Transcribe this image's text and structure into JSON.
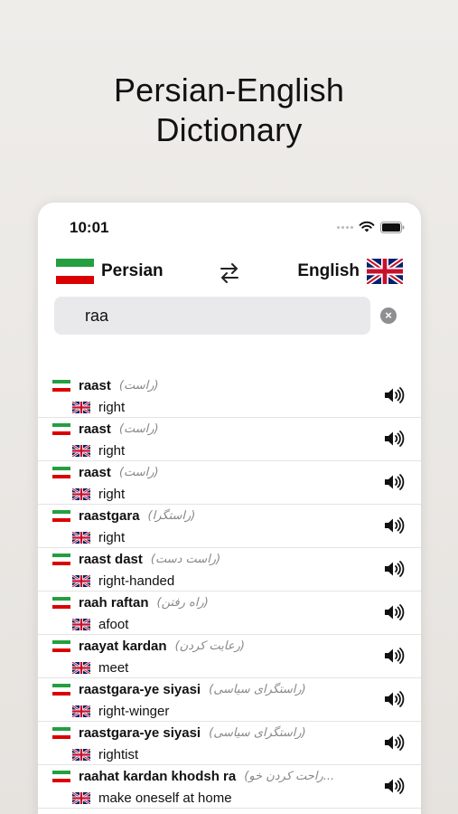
{
  "headline": {
    "line1": "Persian-English",
    "line2": "Dictionary"
  },
  "status": {
    "time": "10:01"
  },
  "languages": {
    "source": "Persian",
    "target": "English"
  },
  "search": {
    "value": "raa"
  },
  "results": [
    {
      "translit": "raast",
      "persian": "(راست)",
      "english": "right"
    },
    {
      "translit": "raast",
      "persian": "(راست)",
      "english": "right"
    },
    {
      "translit": "raast",
      "persian": "(راست)",
      "english": "right"
    },
    {
      "translit": "raastgara",
      "persian": "(راستگرا)",
      "english": "right"
    },
    {
      "translit": "raast dast",
      "persian": "(راست دست)",
      "english": "right-handed"
    },
    {
      "translit": "raah raftan",
      "persian": "(راه رفتن)",
      "english": "afoot"
    },
    {
      "translit": "raayat kardan",
      "persian": "(رعایت کردن)",
      "english": "meet"
    },
    {
      "translit": "raastgara-ye siyasi",
      "persian": "(راستگرای سیاسی)",
      "english": "right-winger"
    },
    {
      "translit": "raastgara-ye siyasi",
      "persian": "(راستگرای سیاسی)",
      "english": "rightist"
    },
    {
      "translit": "raahat kardan khodsh ra",
      "persian": "(راحت کردن خو...",
      "english": "make oneself at home"
    }
  ],
  "colors": {
    "ir_green": "#239f40",
    "ir_red": "#da0000",
    "uk_blue": "#012169",
    "uk_red": "#c8102e"
  },
  "icons": {
    "swap": "swap-arrows-icon",
    "speaker": "speaker-icon",
    "clear": "clear-icon",
    "wifi": "wifi-icon",
    "battery": "battery-icon"
  }
}
